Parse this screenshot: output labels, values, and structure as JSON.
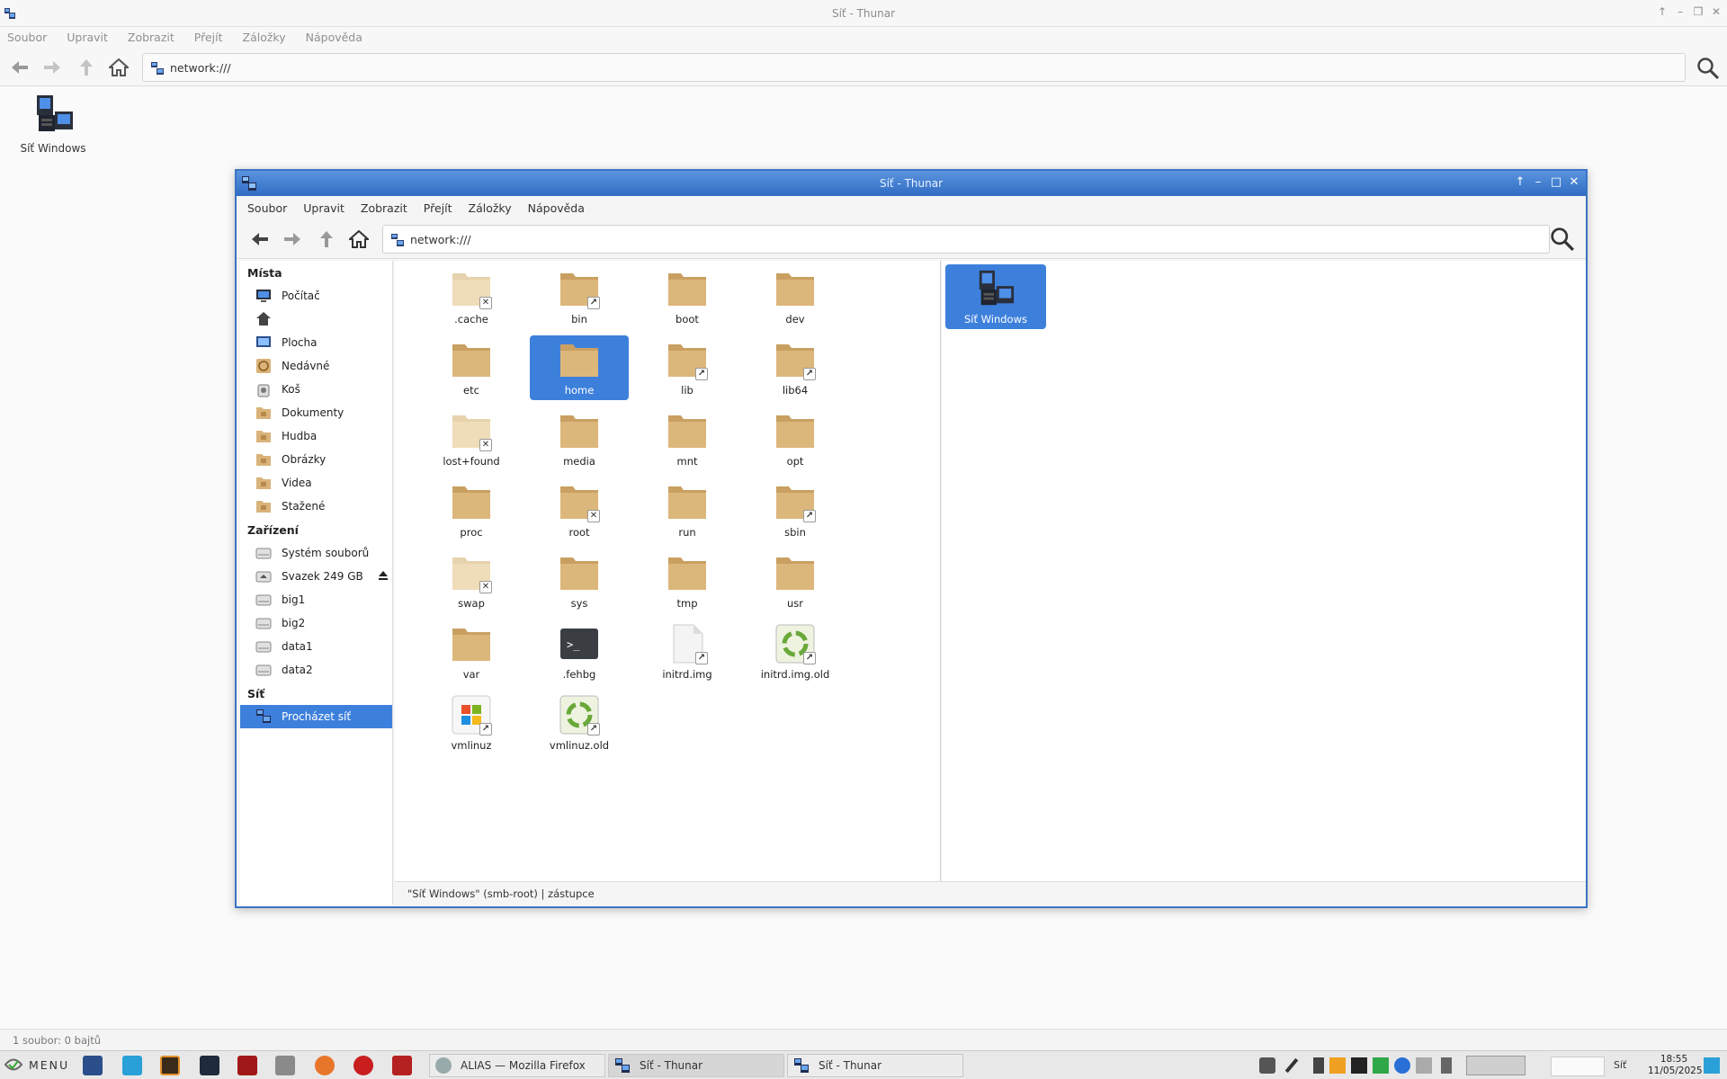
{
  "background_window": {
    "title": "Síť - Thunar",
    "menu": [
      "Soubor",
      "Upravit",
      "Zobrazit",
      "Přejít",
      "Záložky",
      "Nápověda"
    ],
    "location": "network:///",
    "items": [
      {
        "label": "Síť Windows",
        "icon": "network-computers-icon"
      }
    ],
    "status": "1 soubor: 0 bajtů"
  },
  "window": {
    "title": "Síť - Thunar",
    "menu": [
      "Soubor",
      "Upravit",
      "Zobrazit",
      "Přejít",
      "Záložky",
      "Nápověda"
    ],
    "location": "network:///",
    "status": "\"Síť Windows\" (smb-root)  |  zástupce"
  },
  "sidebar": {
    "sections": [
      {
        "title": "Místa",
        "items": [
          {
            "label": "Počítač",
            "icon": "computer-icon"
          },
          {
            "label": "",
            "icon": "home-icon"
          },
          {
            "label": "Plocha",
            "icon": "desktop-icon"
          },
          {
            "label": "Nedávné",
            "icon": "recent-icon"
          },
          {
            "label": "Koš",
            "icon": "trash-icon"
          },
          {
            "label": "Dokumenty",
            "icon": "documents-folder-icon"
          },
          {
            "label": "Hudba",
            "icon": "music-folder-icon"
          },
          {
            "label": "Obrázky",
            "icon": "pictures-folder-icon"
          },
          {
            "label": "Videa",
            "icon": "videos-folder-icon"
          },
          {
            "label": "Stažené",
            "icon": "downloads-folder-icon"
          }
        ]
      },
      {
        "title": "Zařízení",
        "items": [
          {
            "label": "Systém souborů",
            "icon": "drive-icon"
          },
          {
            "label": "Svazek 249 GB",
            "icon": "removable-drive-icon",
            "eject": true
          },
          {
            "label": "big1",
            "icon": "drive-icon"
          },
          {
            "label": "big2",
            "icon": "drive-icon"
          },
          {
            "label": "data1",
            "icon": "drive-icon"
          },
          {
            "label": "data2",
            "icon": "drive-icon"
          }
        ]
      },
      {
        "title": "Síť",
        "items": [
          {
            "label": "Procházet síť",
            "icon": "network-icon",
            "selected": true
          }
        ]
      }
    ]
  },
  "files": [
    {
      "label": ".cache",
      "type": "folder",
      "badge": "x",
      "dim": true
    },
    {
      "label": "bin",
      "type": "folder",
      "badge": "link"
    },
    {
      "label": "boot",
      "type": "folder"
    },
    {
      "label": "dev",
      "type": "folder"
    },
    {
      "label": "etc",
      "type": "folder"
    },
    {
      "label": "home",
      "type": "folder",
      "selected": true
    },
    {
      "label": "lib",
      "type": "folder",
      "badge": "link"
    },
    {
      "label": "lib64",
      "type": "folder",
      "badge": "link"
    },
    {
      "label": "lost+found",
      "type": "folder",
      "badge": "x",
      "dim": true
    },
    {
      "label": "media",
      "type": "folder"
    },
    {
      "label": "mnt",
      "type": "folder"
    },
    {
      "label": "opt",
      "type": "folder"
    },
    {
      "label": "proc",
      "type": "folder"
    },
    {
      "label": "root",
      "type": "folder",
      "badge": "x"
    },
    {
      "label": "run",
      "type": "folder"
    },
    {
      "label": "sbin",
      "type": "folder",
      "badge": "link"
    },
    {
      "label": "swap",
      "type": "folder",
      "badge": "x",
      "dim": true
    },
    {
      "label": "sys",
      "type": "folder"
    },
    {
      "label": "tmp",
      "type": "folder"
    },
    {
      "label": "usr",
      "type": "folder"
    },
    {
      "label": "var",
      "type": "folder"
    },
    {
      "label": ".fehbg",
      "type": "script"
    },
    {
      "label": "initrd.img",
      "type": "file",
      "badge": "link"
    },
    {
      "label": "initrd.img.old",
      "type": "recycle",
      "badge": "link"
    },
    {
      "label": "vmlinuz",
      "type": "windows",
      "badge": "link"
    },
    {
      "label": "vmlinuz.old",
      "type": "recycle",
      "badge": "link"
    }
  ],
  "network_items": [
    {
      "label": "Síť Windows",
      "icon": "network-computers-icon",
      "selected": true
    }
  ],
  "taskbar": {
    "menu_label": "MENU",
    "tasks": [
      {
        "label": "ALIAS — Mozilla Firefox",
        "icon": "firefox-icon"
      },
      {
        "label": "Síť - Thunar",
        "icon": "thunar-icon",
        "active": true
      },
      {
        "label": "Síť - Thunar",
        "icon": "thunar-icon"
      }
    ],
    "network_label": "Síť",
    "time": "18:55",
    "date": "11/05/2025"
  },
  "colors": {
    "accent": "#3d80dc",
    "folder": "#d9b37a",
    "titlebar": "#3b74c4"
  }
}
